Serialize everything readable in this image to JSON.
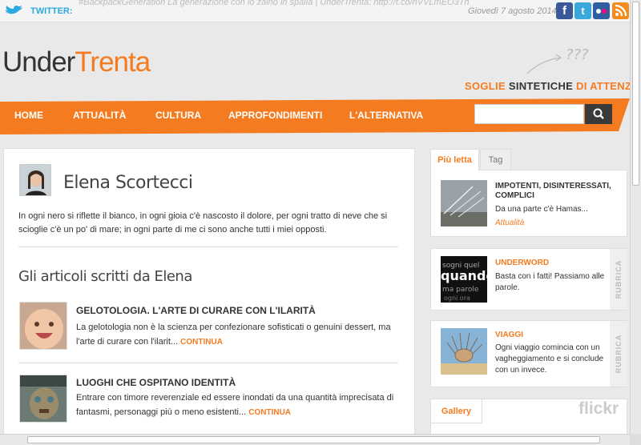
{
  "topbar": {
    "twitter_label": "TWITTER:",
    "tweet": "#BackpackGeneration La generazione con lo zaino in spalla | UnderTrenta: http://t.co/nVVLmEO3Th",
    "date": "Giovedì 7 agosto 2014",
    "social": [
      {
        "icon": "facebook-icon",
        "glyph": "f",
        "color": "#3b5998"
      },
      {
        "icon": "twitter-icon",
        "glyph": "t",
        "color": "#3aa8dc"
      },
      {
        "icon": "flickr-icon",
        "glyph": "",
        "color": "#2f5f9e"
      },
      {
        "icon": "rss-icon",
        "glyph": "))",
        "color": "#f28c1e"
      }
    ]
  },
  "header": {
    "logo_part1": "Under",
    "logo_part2": "Trenta",
    "tagline_part1": "SOGLIE ",
    "tagline_part2": "SINTETICHE ",
    "tagline_part3": "DI ATTENZIONE",
    "deco_text": "???"
  },
  "nav": {
    "items": [
      "HOME",
      "ATTUALITÀ",
      "CULTURA",
      "APPROFONDIMENTI",
      "L'ALTERNATIVA"
    ],
    "search_placeholder": ""
  },
  "main": {
    "author_name": "Elena Scortecci",
    "bio": "In ogni nero si riflette il bianco, in ogni gioia c'è nascosto il dolore, per ogni tratto di neve che si scioglie c'è un po' di mare; in ogni parte di me ci sono anche tutti i miei opposti.",
    "section_title": "Gli articoli scritti da Elena",
    "articles": [
      {
        "title": "GELOTOLOGIA. L'ARTE DI CURARE CON L'ILARITÀ",
        "excerpt": "La gelotologia non è la scienza per confezionare sofisticati o genuini dessert, ma l'arte di curare con l'ilarit...",
        "continue_label": "CONTINUA"
      },
      {
        "title": "LUOGHI CHE OSPITANO IDENTITÀ",
        "excerpt": "Entrare con timore reverenziale ed essere inondati da una quantità imprecisata di fantasmi, personaggi più o meno esistenti...",
        "continue_label": "CONTINUA"
      }
    ]
  },
  "sidebar": {
    "tabs": [
      "Più letta",
      "Tag"
    ],
    "most_read": {
      "title": "IMPOTENTI, DISINTERESSATI, COMPLICI",
      "excerpt": "Da una parte c'è Hamas...",
      "category": "Attualità"
    },
    "rubrics": [
      {
        "title": "UNDERWORD",
        "excerpt": "Basta con i fatti! Passiamo alle parole.",
        "label": "RUBRICA"
      },
      {
        "title": "VIAGGI",
        "excerpt": "Ogni viaggio comincia con un vagheggiamento e si conclude con un invece.",
        "label": "RUBRICA"
      }
    ],
    "gallery_tab": "Gallery",
    "flickr_label": "flickr"
  },
  "colors": {
    "accent": "#f47b20",
    "dark": "#333333",
    "twitter": "#2aa9e0"
  }
}
